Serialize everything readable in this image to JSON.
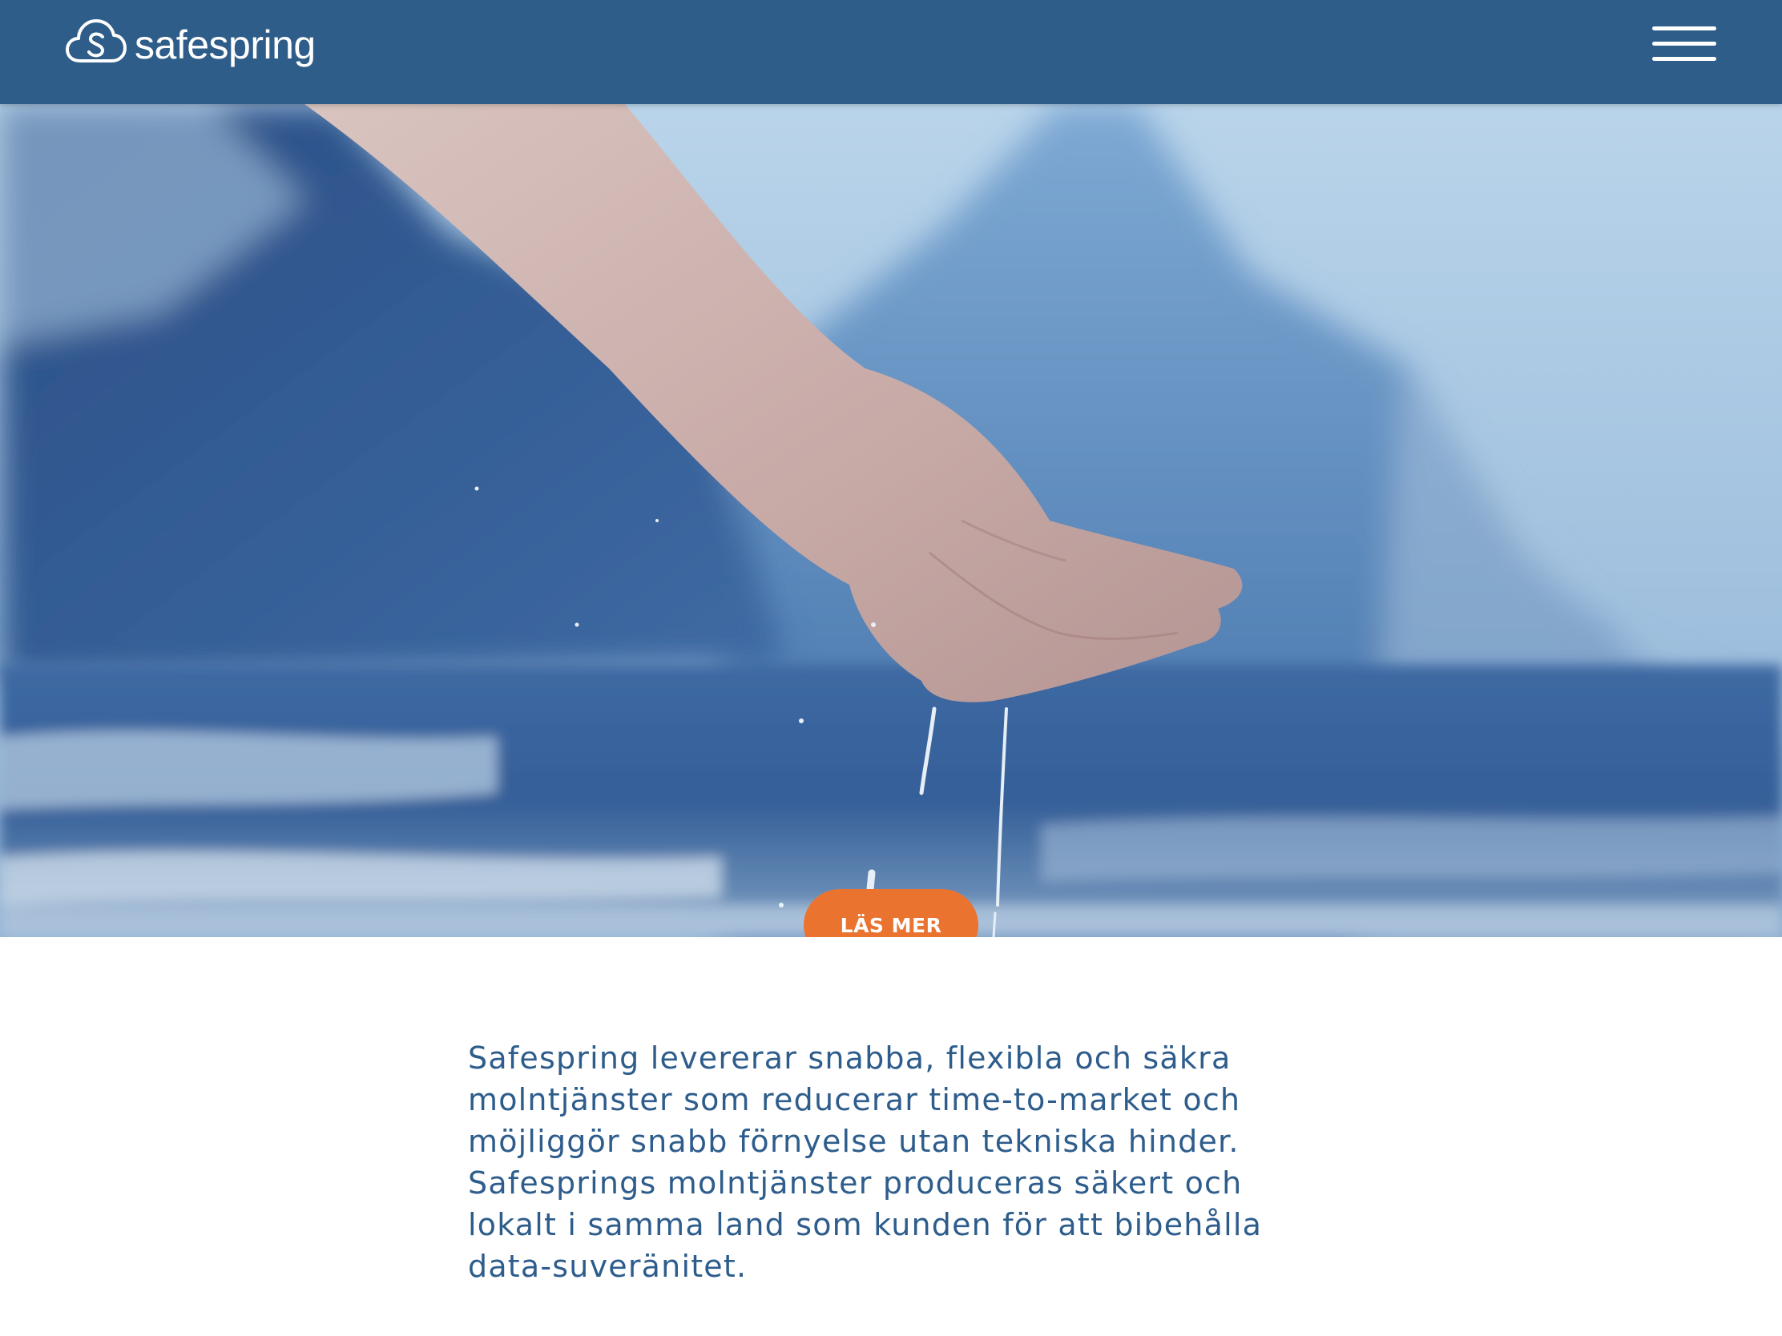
{
  "header": {
    "logo_text": "safespring",
    "logo_icon": "cloud-s-icon",
    "menu_icon": "hamburger-menu-icon"
  },
  "hero": {
    "image": "hand-catching-water-mountains-photo",
    "cta_label": "LÄS MER"
  },
  "intro": {
    "text": "Safespring levererar snabba, flexibla och säkra molntjänster som reducerar time-to-market och möjliggör snabb förnyelse utan tekniska hinder. Safesprings molntjänster produceras säkert och lokalt i samma land som kunden för att bibehålla data-suveränitet."
  },
  "colors": {
    "header_bg": "#2f5d8a",
    "accent": "#ea7330",
    "text": "#2e5d8c"
  }
}
